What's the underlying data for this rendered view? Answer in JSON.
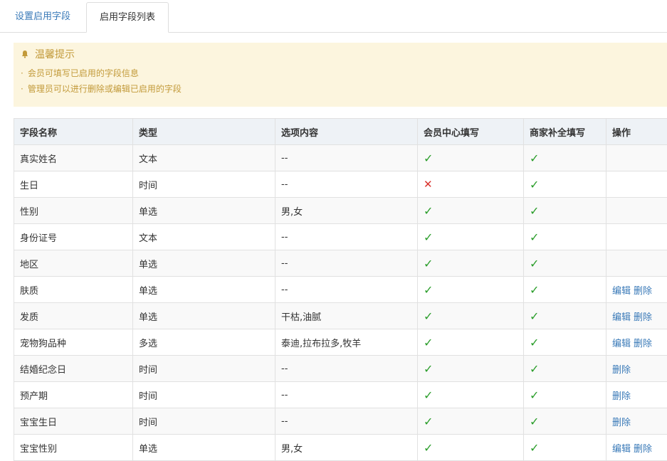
{
  "tabs": [
    {
      "label": "设置启用字段"
    },
    {
      "label": "启用字段列表"
    }
  ],
  "notice": {
    "title": "温馨提示",
    "items": [
      "会员可填写已启用的字段信息",
      "管理员可以进行删除或编辑已启用的字段"
    ]
  },
  "table": {
    "headers": [
      "字段名称",
      "类型",
      "选项内容",
      "会员中心填写",
      "商家补全填写",
      "操作"
    ],
    "rows": [
      {
        "name": "真实姓名",
        "type": "文本",
        "options": "--",
        "member": true,
        "merchant": true,
        "actions": []
      },
      {
        "name": "生日",
        "type": "时间",
        "options": "--",
        "member": false,
        "merchant": true,
        "actions": []
      },
      {
        "name": "性别",
        "type": "单选",
        "options": "男,女",
        "member": true,
        "merchant": true,
        "actions": []
      },
      {
        "name": "身份证号",
        "type": "文本",
        "options": "--",
        "member": true,
        "merchant": true,
        "actions": []
      },
      {
        "name": "地区",
        "type": "单选",
        "options": "--",
        "member": true,
        "merchant": true,
        "actions": []
      },
      {
        "name": "肤质",
        "type": "单选",
        "options": "--",
        "member": true,
        "merchant": true,
        "actions": [
          "编辑",
          "删除"
        ]
      },
      {
        "name": "发质",
        "type": "单选",
        "options": "干枯,油腻",
        "member": true,
        "merchant": true,
        "actions": [
          "编辑",
          "删除"
        ]
      },
      {
        "name": "宠物狗品种",
        "type": "多选",
        "options": "泰迪,拉布拉多,牧羊",
        "member": true,
        "merchant": true,
        "actions": [
          "编辑",
          "删除"
        ]
      },
      {
        "name": "结婚纪念日",
        "type": "时间",
        "options": "--",
        "member": true,
        "merchant": true,
        "actions": [
          "删除"
        ]
      },
      {
        "name": "预产期",
        "type": "时间",
        "options": "--",
        "member": true,
        "merchant": true,
        "actions": [
          "删除"
        ]
      },
      {
        "name": "宝宝生日",
        "type": "时间",
        "options": "--",
        "member": true,
        "merchant": true,
        "actions": [
          "删除"
        ]
      },
      {
        "name": "宝宝性别",
        "type": "单选",
        "options": "男,女",
        "member": true,
        "merchant": true,
        "actions": [
          "编辑",
          "删除"
        ]
      }
    ],
    "check_symbol": "✓",
    "cross_symbol": "✕"
  },
  "colors": {
    "link": "#3a7ab8",
    "check": "#2a9d2a",
    "cross": "#d9322c",
    "notice_bg": "#fcf5de",
    "notice_text": "#c29a3a"
  }
}
